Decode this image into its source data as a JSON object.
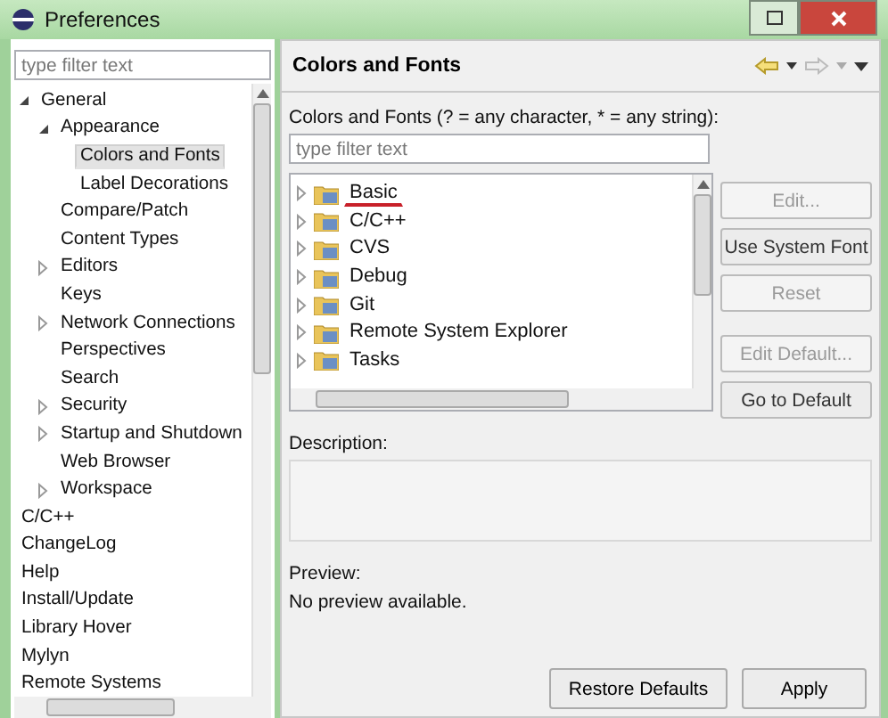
{
  "window": {
    "title": "Preferences"
  },
  "sidebar": {
    "filter": {
      "placeholder": "type filter text"
    },
    "tree": [
      {
        "label": "General",
        "kind": "folder",
        "expanded": true,
        "selected": false,
        "children": [
          {
            "label": "Appearance",
            "kind": "folder",
            "expanded": true,
            "selected": false,
            "children": [
              {
                "label": "Colors and Fonts",
                "kind": "leaf",
                "selected": true
              },
              {
                "label": "Label Decorations",
                "kind": "leaf",
                "selected": false
              }
            ]
          },
          {
            "label": "Compare/Patch",
            "kind": "leaf",
            "selected": false
          },
          {
            "label": "Content Types",
            "kind": "leaf",
            "selected": false
          },
          {
            "label": "Editors",
            "kind": "folder",
            "expanded": false,
            "selected": false
          },
          {
            "label": "Keys",
            "kind": "leaf",
            "selected": false
          },
          {
            "label": "Network Connections",
            "kind": "folder",
            "expanded": false,
            "selected": false
          },
          {
            "label": "Perspectives",
            "kind": "leaf",
            "selected": false
          },
          {
            "label": "Search",
            "kind": "leaf",
            "selected": false
          },
          {
            "label": "Security",
            "kind": "folder",
            "expanded": false,
            "selected": false
          },
          {
            "label": "Startup and Shutdown",
            "kind": "folder",
            "expanded": false,
            "selected": false
          },
          {
            "label": "Web Browser",
            "kind": "leaf",
            "selected": false
          },
          {
            "label": "Workspace",
            "kind": "folder",
            "expanded": false,
            "selected": false
          }
        ]
      },
      {
        "label": "C/C++",
        "kind": "leaf",
        "selected": false
      },
      {
        "label": "ChangeLog",
        "kind": "leaf",
        "selected": false
      },
      {
        "label": "Help",
        "kind": "leaf",
        "selected": false
      },
      {
        "label": "Install/Update",
        "kind": "leaf",
        "selected": false
      },
      {
        "label": "Library Hover",
        "kind": "leaf",
        "selected": false
      },
      {
        "label": "Mylyn",
        "kind": "leaf",
        "selected": false
      },
      {
        "label": "Remote Systems",
        "kind": "leaf",
        "selected": false
      }
    ]
  },
  "page": {
    "title": "Colors and Fonts",
    "filter_label": "Colors and Fonts (? = any character, * = any string):",
    "filter": {
      "placeholder": "type filter text"
    },
    "categories": [
      {
        "label": "Basic",
        "underlined": true
      },
      {
        "label": "C/C++",
        "underlined": false
      },
      {
        "label": "CVS",
        "underlined": false
      },
      {
        "label": "Debug",
        "underlined": false
      },
      {
        "label": "Git",
        "underlined": false
      },
      {
        "label": "Remote System Explorer",
        "underlined": false
      },
      {
        "label": "Tasks",
        "underlined": false
      }
    ],
    "side_buttons": [
      {
        "label": "Edit...",
        "disabled": true
      },
      {
        "label": "Use System Font",
        "disabled": false
      },
      {
        "label": "Reset",
        "disabled": true
      }
    ],
    "default_buttons": [
      {
        "label": "Edit Default...",
        "disabled": true
      },
      {
        "label": "Go to Default",
        "disabled": false
      }
    ],
    "description_label": "Description:",
    "preview_label": "Preview:",
    "preview_text": "No preview available."
  },
  "buttons": [
    "Restore Defaults",
    "Apply"
  ]
}
